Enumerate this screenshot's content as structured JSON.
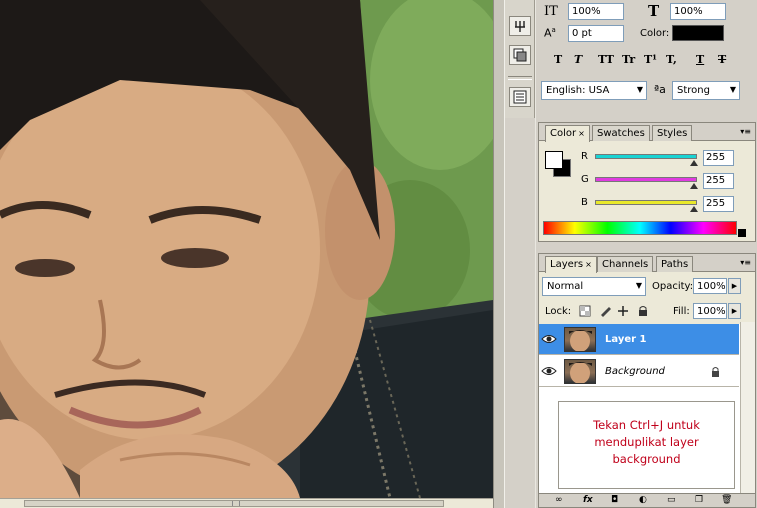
{
  "character": {
    "vertical_scale": "100%",
    "horizontal_scale": "100%",
    "baseline_shift": "0 pt",
    "color_label": "Color:",
    "style_buttons": [
      "T",
      "T",
      "TT",
      "Tr",
      "T¹",
      "T,",
      "T",
      "T"
    ],
    "language": "English: USA",
    "antialias_label": "ªa",
    "antialias": "Strong"
  },
  "color_panel": {
    "tabs": [
      "Color",
      "Swatches",
      "Styles"
    ],
    "close_glyph": "×",
    "channels": [
      {
        "label": "R",
        "value": "255",
        "track": "#19d3d3"
      },
      {
        "label": "G",
        "value": "255",
        "track": "#e03be0"
      },
      {
        "label": "B",
        "value": "255",
        "track": "#e8e82a"
      }
    ]
  },
  "layers_panel": {
    "tabs": [
      "Layers",
      "Channels",
      "Paths"
    ],
    "close_glyph": "×",
    "blend_mode": "Normal",
    "opacity_label": "Opacity:",
    "opacity": "100%",
    "lock_label": "Lock:",
    "fill_label": "Fill:",
    "fill": "100%",
    "layers": [
      {
        "name": "Layer 1",
        "selected": true
      },
      {
        "name": "Background",
        "selected": false,
        "locked": true
      }
    ],
    "note_lines": [
      "Tekan Ctrl+J untuk",
      "menduplikat layer",
      "background"
    ]
  },
  "colors": {
    "selection": "#3d8ee6",
    "note_text": "#c0001a",
    "swatch_fg": "#000000"
  }
}
